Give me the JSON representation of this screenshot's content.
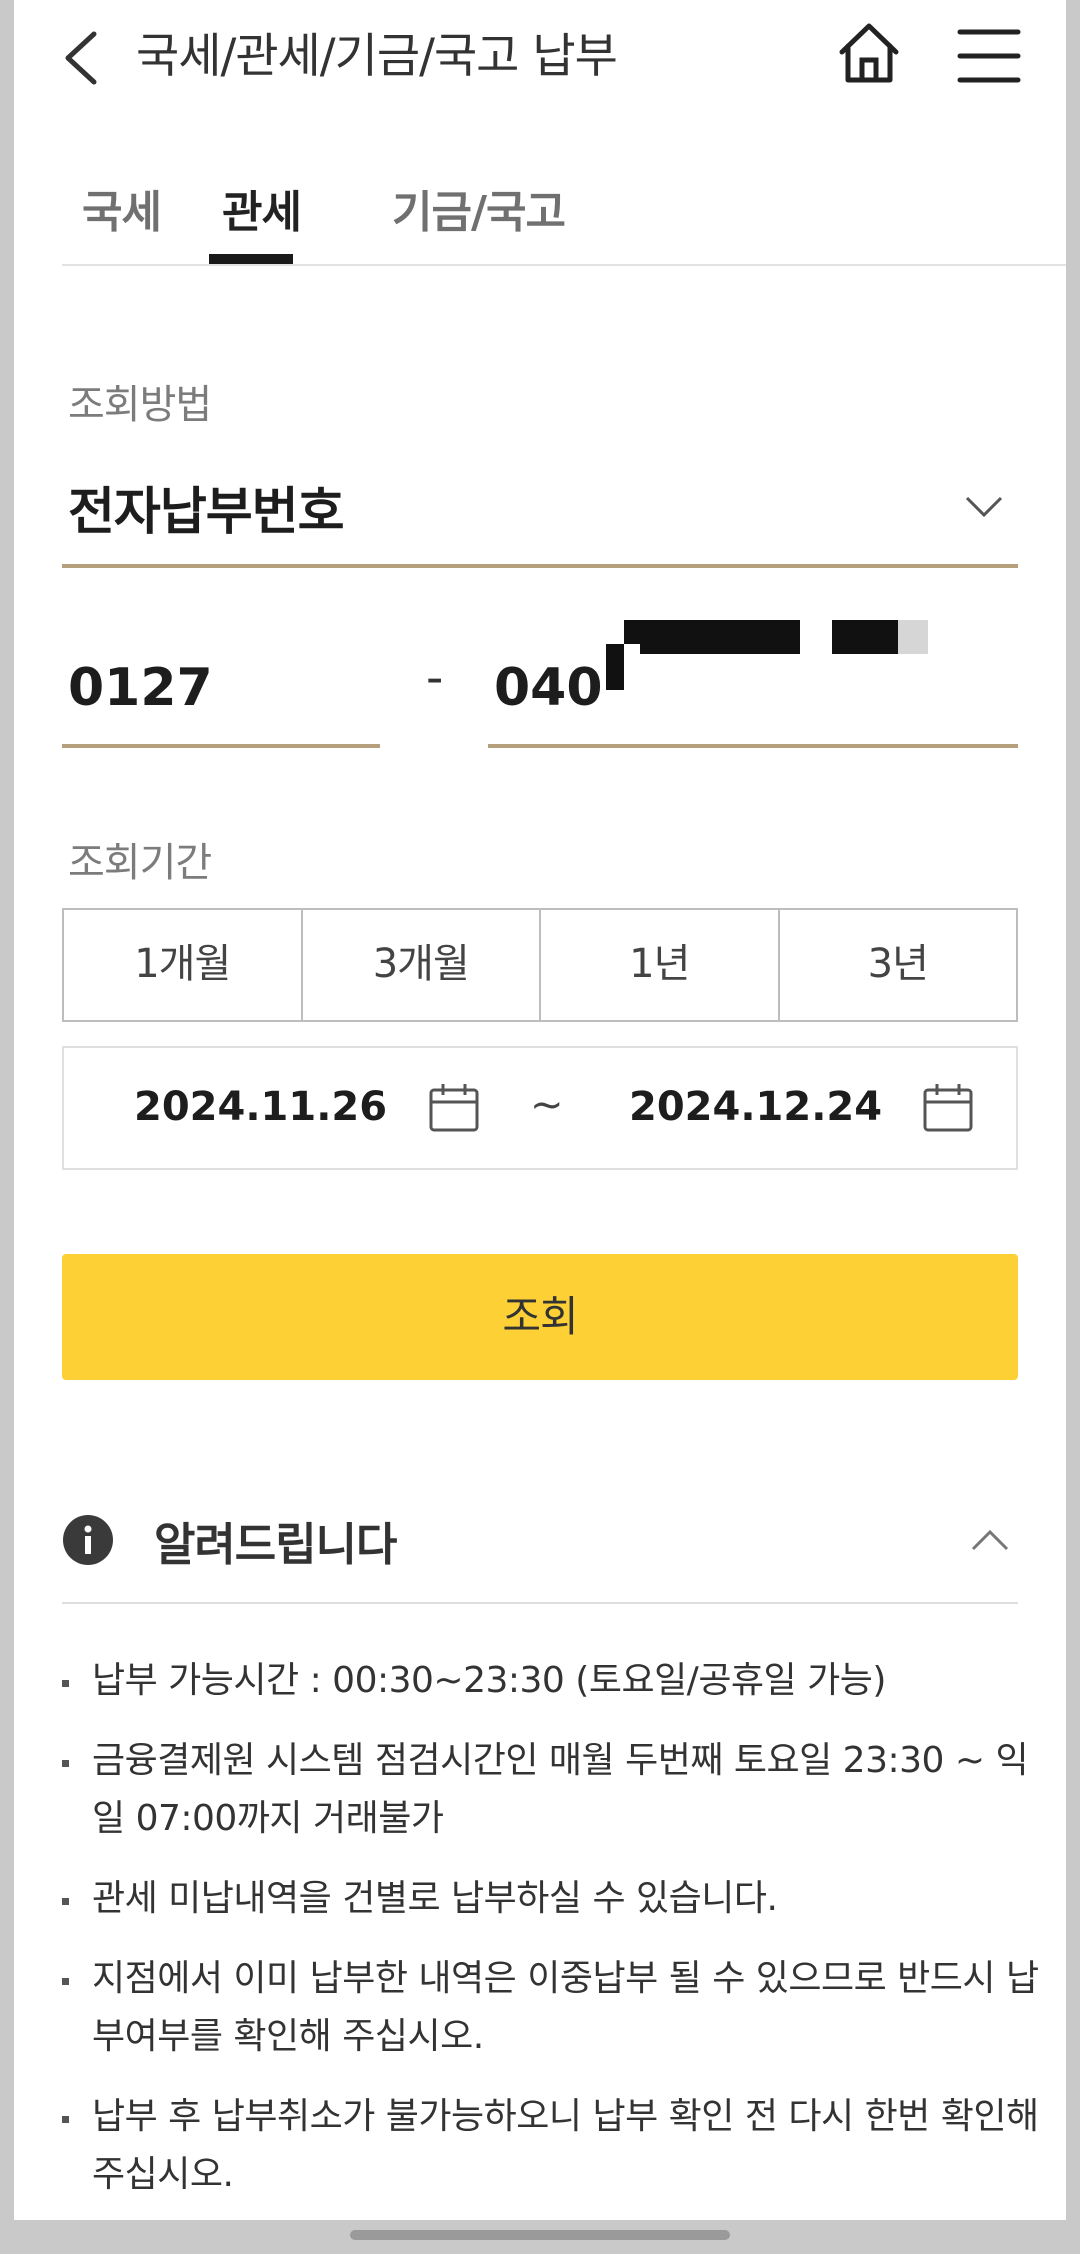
{
  "header": {
    "title": "국세/관세/기금/국고 납부",
    "back_icon": "chevron-left-icon",
    "home_icon": "home-icon",
    "menu_icon": "hamburger-menu-icon"
  },
  "tabs": [
    {
      "label": "국세",
      "active": false
    },
    {
      "label": "관세",
      "active": true
    },
    {
      "label": "기금/국고",
      "active": false
    }
  ],
  "form": {
    "method_label": "조회방법",
    "method_value": "전자납부번호",
    "number_part1": "0127",
    "separator": "-",
    "number_part2": "040",
    "period_label": "조회기간",
    "period_options": [
      "1개월",
      "3개월",
      "1년",
      "3년"
    ],
    "date_from": "2024.11.26",
    "date_separator": "~",
    "date_to": "2024.12.24",
    "search_label": "조회"
  },
  "notice": {
    "title": "알려드립니다",
    "items": [
      "납부 가능시간 : 00:30~23:30 (토요일/공휴일 가능)",
      "금융결제원 시스템 점검시간인 매월 두번째 토요일 23:30 ~ 익일 07:00까지 거래불가",
      "관세 미납내역을 건별로 납부하실 수 있습니다.",
      "지점에서 이미 납부한 내역은 이중납부 될 수 있으므로 반드시 납부여부를 확인해 주십시오.",
      "납부 후 납부취소가 불가능하오니 납부 확인 전 다시 한번 확인해 주십시오."
    ]
  },
  "colors": {
    "accent_gold": "#b59f7c",
    "primary_button": "#fdd136",
    "background_frame": "#c9c9c9"
  }
}
